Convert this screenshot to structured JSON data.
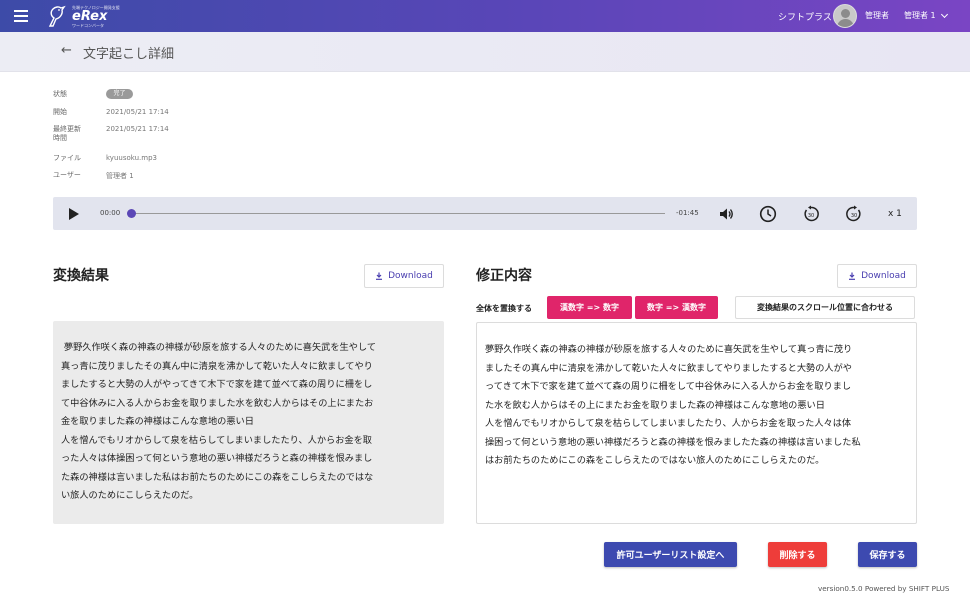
{
  "header": {
    "logo_small": "先端テクノロジー開発支援",
    "logo_main": "eRex",
    "logo_sub": "ワードコンバータ",
    "company": "シフトプラス",
    "role": "管理者",
    "user": "管理者 1"
  },
  "page": {
    "back_symbol": "←",
    "title": "文字起こし詳細"
  },
  "meta": {
    "status_label": "状態",
    "status_value": "完了",
    "start_label": "開始",
    "start_value": "2021/05/21 17:14",
    "updated_label_1": "最終更新",
    "updated_label_2": "時間",
    "updated_value": "2021/05/21 17:14",
    "file_label": "ファイル",
    "file_value": "kyuusoku.mp3",
    "user_label": "ユーザー",
    "user_value": "管理者 1"
  },
  "player": {
    "current_time": "00:00",
    "remaining_time": "-01:45",
    "speed": "x 1",
    "progress": 0,
    "icons": [
      "play-icon",
      "volume-icon",
      "clock-icon",
      "rewind-30-icon",
      "forward-30-icon"
    ]
  },
  "left": {
    "title": "変換結果",
    "download": "Download",
    "text": " 夢野久作咲く森の神森の神様が砂原を旅する人々のために喜矢武を生やして\n真っ青に茂りましたその真ん中に清泉を沸かして乾いた人々に飲ましてやり\nましたすると大勢の人がやってきて木下で家を建て並べて森の周りに柵をし\nて中谷休みに入る人からお金を取りました水を飲む人からはその上にまたお\n金を取りました森の神様はこんな意地の悪い日\n人を憎んでもリオからして泉を枯らしてしまいましたたり、人からお金を取\nった人々は体操困って何という意地の悪い神様だろうと森の神様を恨みまし\nた森の神様は言いました私はお前たちのためにこの森をこしらえたのではな\nい旅人のためにこしらえたのだ。"
  },
  "right": {
    "title": "修正内容",
    "download": "Download",
    "replace_all": "全体を置換する",
    "kanji_to_num": "漢数字 => 数字",
    "num_to_kanji": "数字 => 漢数字",
    "sync_scroll": "変換結果のスクロール位置に合わせる",
    "text": "夢野久作咲く森の神森の神様が砂原を旅する人々のために喜矢武を生やして真っ青に茂り\nましたその真ん中に清泉を沸かして乾いた人々に飲ましてやりましたすると大勢の人がや\nってきて木下で家を建て並べて森の周りに柵をして中谷休みに入る人からお金を取りまし\nた水を飲む人からはその上にまたお金を取りました森の神様はこんな意地の悪い日\n人を憎んでもリオからして泉を枯らしてしまいましたたり、人からお金を取った人々は体\n操困って何という意地の悪い神様だろうと森の神様を恨みましたた森の神様は言いました私\nはお前たちのためにこの森をこしらえたのではない旅人のためにこしらえたのだ。"
  },
  "actions": {
    "allowed_users": "許可ユーザーリスト設定へ",
    "delete": "削除する",
    "save": "保存する"
  },
  "footer": {
    "text": "version0.5.0    Powered by SHIFT PLUS"
  },
  "colors": {
    "accent": "#4a3fb0",
    "pink": "#e0256a",
    "delete": "#ee3d3a",
    "blue_button": "#3d4ab0"
  }
}
